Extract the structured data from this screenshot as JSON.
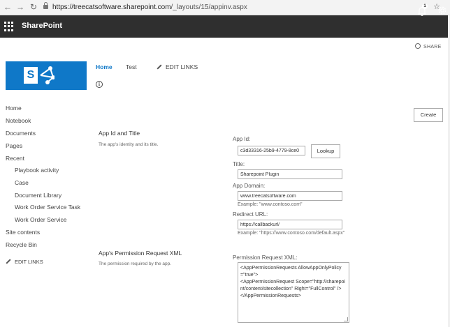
{
  "browser": {
    "back": "←",
    "forward": "→",
    "reload": "↻",
    "url_host": "https://treecatsoftware.sharepoint.com",
    "url_path": "/_layouts/15/appinv.aspx",
    "star": "☆"
  },
  "suitebar": {
    "brand": "SharePoint",
    "notification_count": "1",
    "icons": [
      "app-launcher-icon",
      "bell-icon",
      "gear-icon"
    ]
  },
  "ribbon": {
    "share_label": "SHARE"
  },
  "topnav": {
    "home": "Home",
    "test": "Test",
    "edit_links": "EDIT LINKS",
    "info": "i"
  },
  "leftnav": {
    "items": [
      {
        "label": "Home",
        "sub": false
      },
      {
        "label": "Notebook",
        "sub": false
      },
      {
        "label": "Documents",
        "sub": false
      },
      {
        "label": "Pages",
        "sub": false
      },
      {
        "label": "Recent",
        "sub": false
      },
      {
        "label": "Playbook activity",
        "sub": true
      },
      {
        "label": "Case",
        "sub": true
      },
      {
        "label": "Document Library",
        "sub": true
      },
      {
        "label": "Work Order Service Task",
        "sub": true
      },
      {
        "label": "Work Order Service",
        "sub": true
      },
      {
        "label": "Site contents",
        "sub": false
      },
      {
        "label": "Recycle Bin",
        "sub": false
      }
    ],
    "edit_links": "EDIT LINKS"
  },
  "form": {
    "create_label": "Create",
    "section1": {
      "title": "App Id and Title",
      "description": "The app's identity and its title."
    },
    "app_id": {
      "label": "App Id:",
      "value": "c3d33316-25b9-4779-8ce0",
      "lookup_label": "Lookup"
    },
    "title": {
      "label": "Title:",
      "value": "Sharepoint Plugin"
    },
    "app_domain": {
      "label": "App Domain:",
      "value": "www.treecatsoftware.com",
      "example": "Example: \"www.contoso.com\""
    },
    "redirect_url": {
      "label": "Redirect URL:",
      "value": "https://callbackurl/",
      "example": "Example: \"https://www.contoso.com/default.aspx\""
    },
    "section2": {
      "title": "App's Permission Request XML",
      "description": "The permission required by the app."
    },
    "permission_xml": {
      "label": "Permission Request XML:",
      "value": "<AppPermissionRequests AllowAppOnlyPolicy=\"true\">\n<AppPermissionRequest Scope=\"http://sharepoint/content/sitecollection\" Right=\"FullControl\" />\n</AppPermissionRequests>"
    }
  }
}
